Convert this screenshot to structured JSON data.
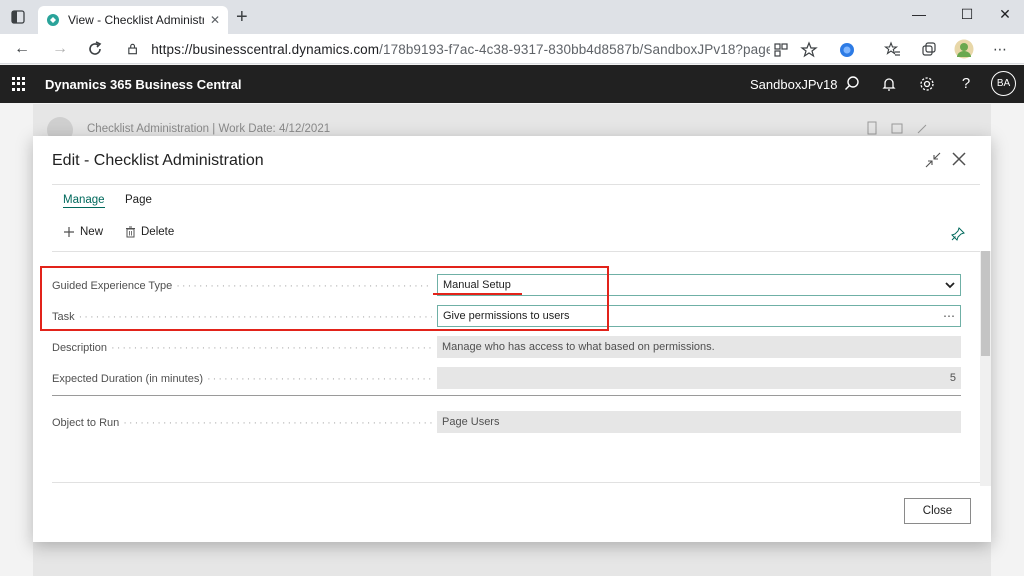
{
  "browser": {
    "tab_title": "View - Checklist Administration -",
    "url_host": "https://businesscentral.dynamics.com",
    "url_path": "/178b9193-f7ac-4c38-9317-830bb4d8587b/SandboxJPv18?page=19..."
  },
  "appbar": {
    "product": "Dynamics 365 Business Central",
    "environment": "SandboxJPv18",
    "avatar": "BA"
  },
  "background_page": {
    "title": "Checklist Administration | Work Date: 4/12/2021"
  },
  "dialog": {
    "title": "Edit - Checklist Administration",
    "menu": [
      {
        "label": "Manage",
        "active": true
      },
      {
        "label": "Page",
        "active": false
      }
    ],
    "actions": {
      "new_label": "New",
      "delete_label": "Delete"
    },
    "fields": [
      {
        "label": "Guided Experience Type",
        "value": "Manual Setup",
        "kind": "dropdown"
      },
      {
        "label": "Task",
        "value": "Give permissions to users",
        "kind": "lookup"
      },
      {
        "label": "Description",
        "value": "Manage who has access to what based on permissions.",
        "kind": "readonly"
      },
      {
        "label": "Expected Duration (in minutes)",
        "value": "5",
        "kind": "readonly"
      },
      {
        "label": "Object to Run",
        "value": "Page Users",
        "kind": "readonly"
      }
    ],
    "close_label": "Close"
  },
  "colors": {
    "accent": "#00695c",
    "appbar": "#212121",
    "annotation": "#e2231a"
  }
}
